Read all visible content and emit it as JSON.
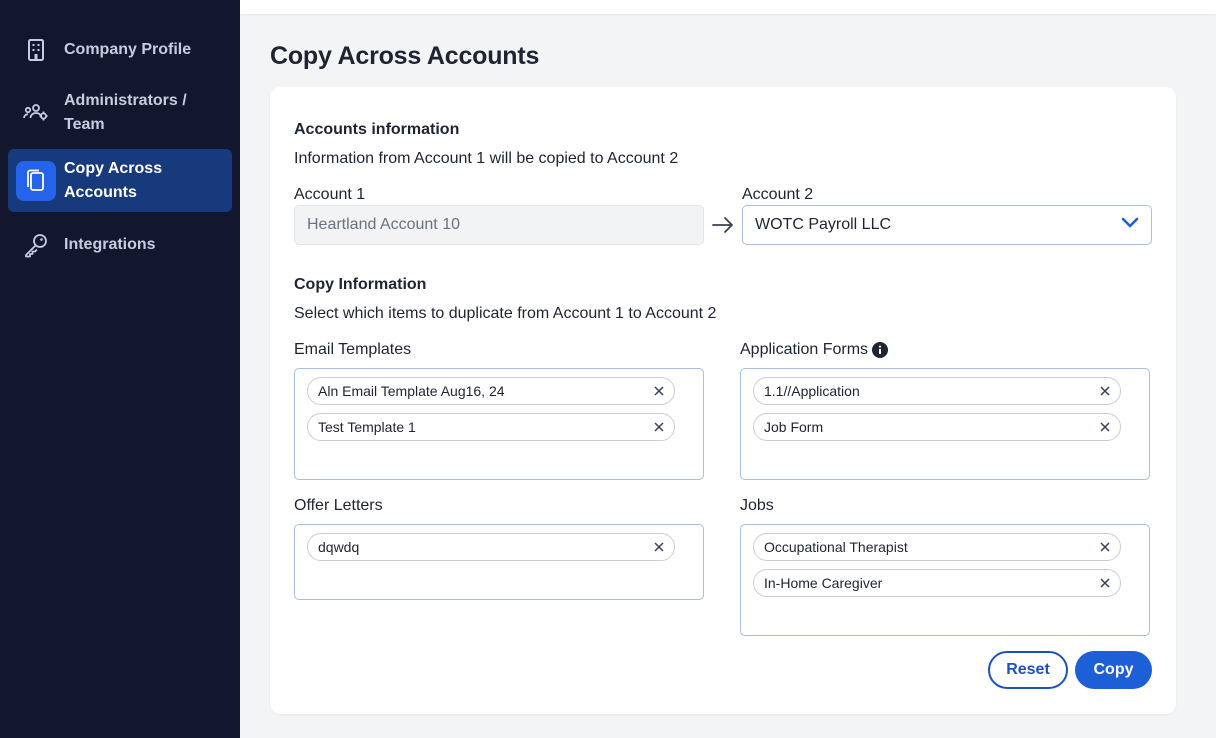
{
  "sidebar": {
    "items": [
      {
        "label": "Company Profile",
        "icon": "building-icon",
        "active": false
      },
      {
        "label": "Administrators / Team",
        "icon": "users-icon",
        "active": false
      },
      {
        "label": "Copy Across Accounts",
        "icon": "copy-icon",
        "active": true
      },
      {
        "label": "Integrations",
        "icon": "key-icon",
        "active": false
      }
    ]
  },
  "page": {
    "title": "Copy Across Accounts"
  },
  "accounts": {
    "title": "Accounts information",
    "description": "Information from Account 1 will be copied to Account 2",
    "account1_label": "Account 1",
    "account1_value": "Heartland Account 10",
    "account2_label": "Account 2",
    "account2_value": "WOTC Payroll LLC"
  },
  "copy_info": {
    "title": "Copy Information",
    "description": "Select which items to duplicate from Account 1 to Account 2"
  },
  "email_templates": {
    "label": "Email Templates",
    "items": [
      "Aln Email Template Aug16, 24",
      "Test Template 1"
    ]
  },
  "application_forms": {
    "label": "Application Forms",
    "items": [
      "1.1//Application",
      "Job Form"
    ]
  },
  "offer_letters": {
    "label": "Offer Letters",
    "items": [
      "dqwdq"
    ]
  },
  "jobs": {
    "label": "Jobs",
    "items": [
      "Occupational Therapist",
      "In-Home Caregiver"
    ]
  },
  "actions": {
    "reset_label": "Reset",
    "copy_label": "Copy"
  },
  "colors": {
    "sidebar_bg": "#13172d",
    "active_bg": "#163a7c",
    "accent": "#1d5fd6"
  }
}
